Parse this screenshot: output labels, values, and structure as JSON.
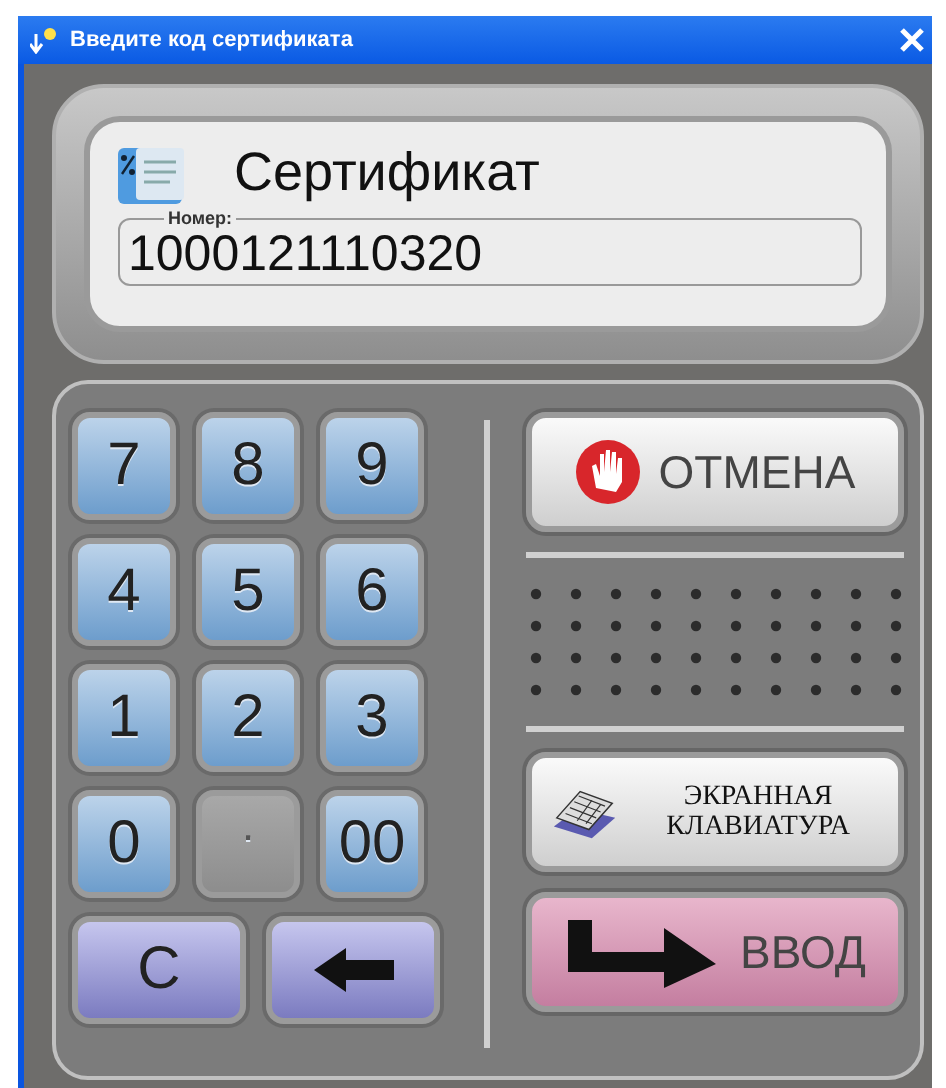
{
  "window": {
    "title": "Введите код сертификата"
  },
  "display": {
    "title": "Сертификат",
    "field_label": "Номер:",
    "value": "1000121110320"
  },
  "keys": [
    {
      "kind": "digit",
      "label": "7",
      "disabled": false
    },
    {
      "kind": "digit",
      "label": "8",
      "disabled": false
    },
    {
      "kind": "digit",
      "label": "9",
      "disabled": false
    },
    {
      "kind": "digit",
      "label": "4",
      "disabled": false
    },
    {
      "kind": "digit",
      "label": "5",
      "disabled": false
    },
    {
      "kind": "digit",
      "label": "6",
      "disabled": false
    },
    {
      "kind": "digit",
      "label": "1",
      "disabled": false
    },
    {
      "kind": "digit",
      "label": "2",
      "disabled": false
    },
    {
      "kind": "digit",
      "label": "3",
      "disabled": false
    },
    {
      "kind": "digit",
      "label": "0",
      "disabled": false
    },
    {
      "kind": "digit",
      "label": ".",
      "disabled": true
    },
    {
      "kind": "digit",
      "label": "00",
      "disabled": false
    }
  ],
  "function_keys": [
    {
      "kind": "clear",
      "label": "C"
    },
    {
      "kind": "backspace"
    }
  ],
  "actions": [
    {
      "kind": "cancel",
      "label": "ОТМЕНА"
    },
    {
      "kind": "keyboard",
      "label": "ЭКРАННАЯ КЛАВИАТУРА"
    },
    {
      "kind": "enter",
      "label": "ВВОД"
    }
  ]
}
